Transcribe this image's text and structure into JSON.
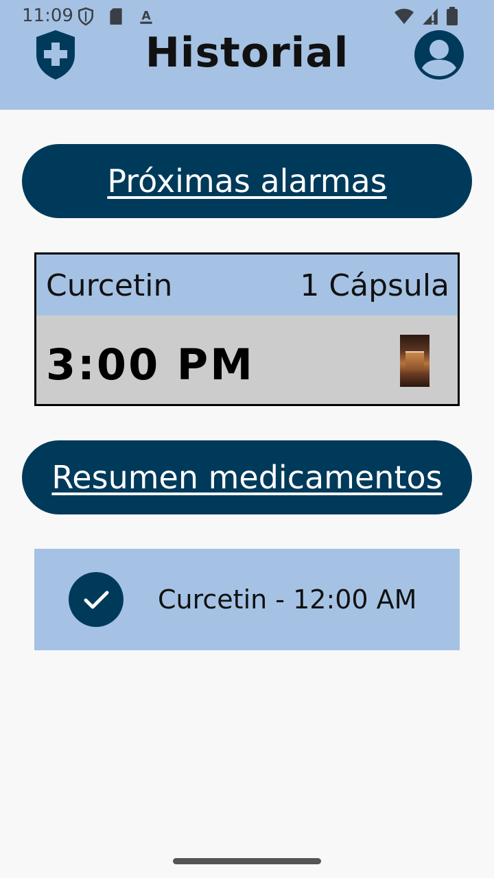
{
  "status_bar": {
    "time": "11:09",
    "left_icons": [
      "shield-status-icon",
      "sd-card-icon",
      "keyboard-a-icon"
    ],
    "right_icons": [
      "wifi-icon",
      "signal-icon",
      "battery-icon"
    ]
  },
  "header": {
    "title": "Historial",
    "left_icon": "medical-shield-icon",
    "right_icon": "account-icon"
  },
  "upcoming": {
    "section_label": "Próximas alarmas",
    "alarm": {
      "medication": "Curcetin",
      "dose": "1 Cápsula",
      "time": "3:00 PM"
    }
  },
  "summary": {
    "section_label": "Resumen medicamentos",
    "items": [
      {
        "text": "Curcetin - 12:00 AM",
        "status": "taken"
      }
    ]
  },
  "colors": {
    "header_bg": "#a5c2e4",
    "accent_dark": "#003a5b",
    "card_bottom": "#cccccc"
  }
}
